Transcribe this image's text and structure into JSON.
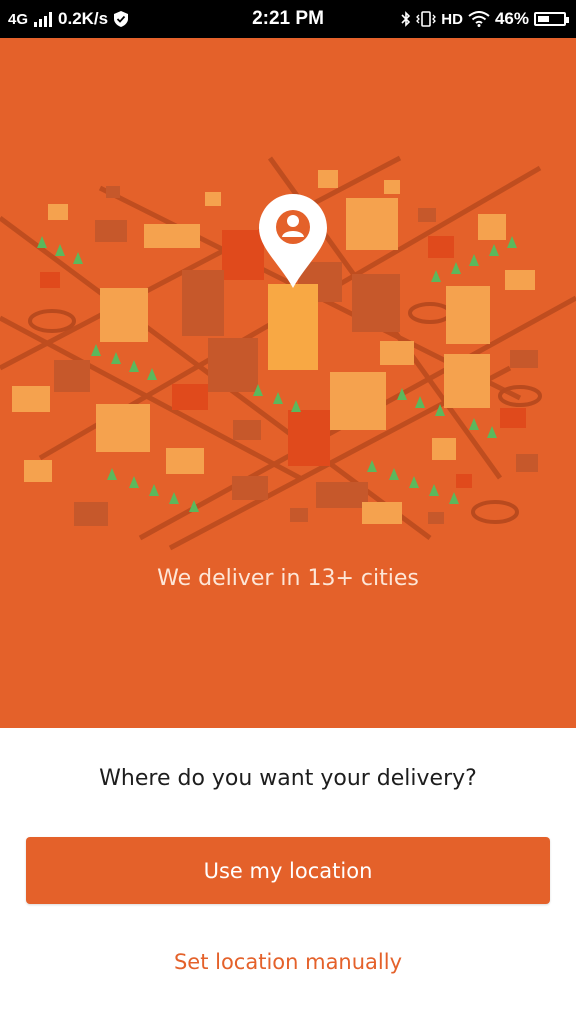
{
  "status_bar": {
    "network_type": "4G",
    "speed": "0.2K/s",
    "time": "2:21 PM",
    "hd_label": "HD",
    "battery_percent": "46%",
    "battery_level": 0.46,
    "icons": [
      "signal-icon",
      "shield-check-icon",
      "bluetooth-icon",
      "vibrate-icon",
      "wifi-icon",
      "battery-icon"
    ]
  },
  "hero": {
    "tagline": "We deliver in 13+ cities",
    "illustration": "isometric-city-map-with-location-pin"
  },
  "prompt": {
    "title": "Where do you want your delivery?"
  },
  "actions": {
    "use_location_label": "Use my location",
    "set_manually_label": "Set location manually"
  },
  "colors": {
    "brand": "#e4612a",
    "white": "#ffffff",
    "text": "#1d1d1d"
  }
}
